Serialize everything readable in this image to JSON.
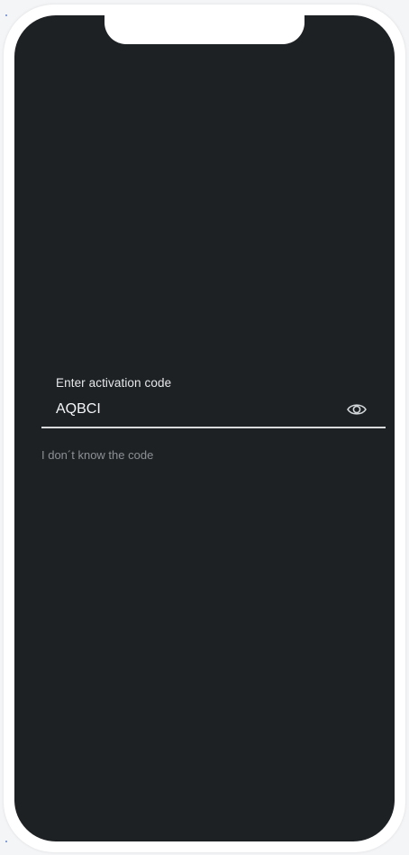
{
  "activation": {
    "label": "Enter activation code",
    "value": "AQBCI",
    "help_link": "I don´t know the code"
  },
  "icons": {
    "toggle_visibility": "eye-icon"
  },
  "colors": {
    "screen_background": "#1e2124",
    "frame": "#ffffff",
    "text_primary": "#f4f6f8",
    "text_secondary": "#8c9094",
    "underline": "#d8dadc"
  }
}
